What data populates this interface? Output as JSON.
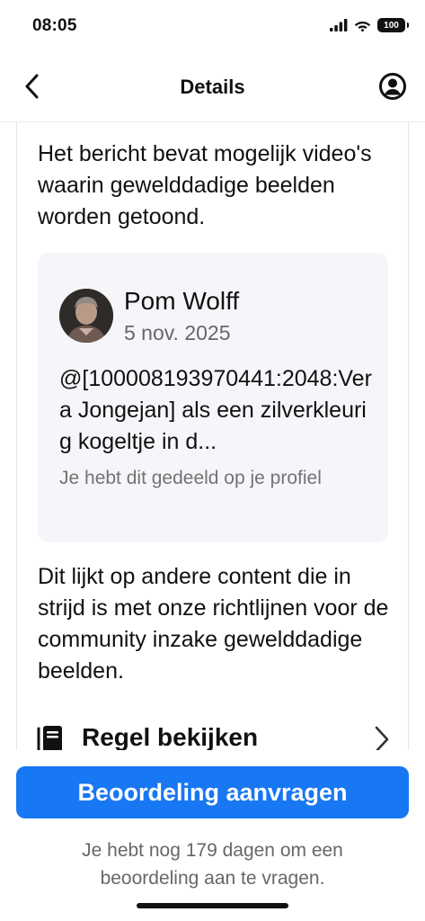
{
  "status_bar": {
    "time": "08:05",
    "battery": "100",
    "icons": [
      "signal-icon",
      "wifi-icon",
      "battery-icon"
    ]
  },
  "nav": {
    "title": "Details",
    "back_icon": "chevron-left-icon",
    "profile_icon": "account-circle-icon"
  },
  "content": {
    "intro": "Het bericht bevat mogelijk video's waarin gewelddadige beelden worden getoond.",
    "post": {
      "author": "Pom Wolff",
      "date": "5 nov. 2025",
      "text": "@[100008193970441:2048:Vera Jongejan] als een zilverkleurig kogeltje in d...",
      "note": "Je hebt dit gedeeld op je profiel"
    },
    "policy": "Dit lijkt op andere content die in strijd is met onze richtlijnen voor de community inzake gewelddadige beelden.",
    "rule_link": {
      "label": "Regel bekijken",
      "icon": "book-icon",
      "chevron": "chevron-right-icon"
    }
  },
  "footer": {
    "button_label": "Beoordeling aanvragen",
    "helper": "Je hebt nog 179 dagen om een beoordeling aan te vragen."
  },
  "colors": {
    "primary": "#1877f2",
    "secondary_text": "#65676b",
    "card_bg": "#f5f6f9"
  }
}
